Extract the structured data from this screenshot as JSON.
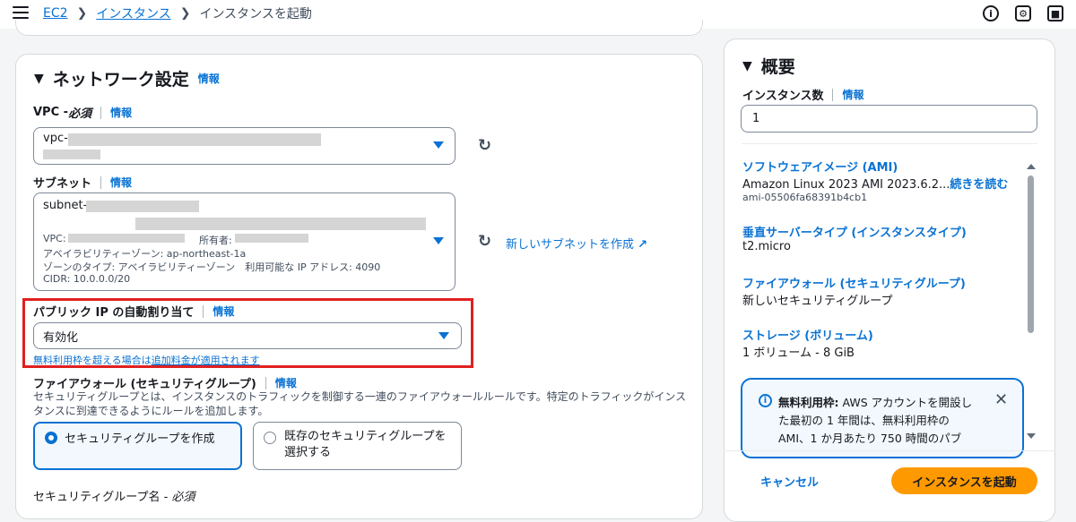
{
  "breadcrumb": {
    "ec2": "EC2",
    "instances": "インスタンス",
    "current": "インスタンスを起動"
  },
  "topbar_icons": [
    "info-icon",
    "settings-icon",
    "feedback-icon"
  ],
  "network": {
    "title": "ネットワーク設定",
    "info": "情報",
    "vpc": {
      "label": "VPC - ",
      "required": "必須",
      "info": "情報",
      "value": "vpc-"
    },
    "subnet": {
      "label": "サブネット",
      "info": "情報",
      "value": "subnet-",
      "vpc_line": "VPC:",
      "owner": "所有者:",
      "az": "アベイラビリティーゾーン: ap-northeast-1a",
      "zone_type": "ゾーンのタイプ: アベイラビリティーゾーン　利用可能な IP アドレス: 4090",
      "cidr": "CIDR: 10.0.0.0/20",
      "create_link": "新しいサブネットを作成"
    },
    "public_ip": {
      "label": "パブリック IP の自動割り当て",
      "info": "情報",
      "value": "有効化",
      "note_pre": "無料利用枠を超える場合は",
      "note_link": "追加料金が適用されます"
    },
    "firewall": {
      "label": "ファイアウォール (セキュリティグループ)",
      "info": "情報",
      "desc": "セキュリティグループとは、インスタンスのトラフィックを制御する一連のファイアウォールルールです。特定のトラフィックがインスタンスに到達できるようにルールを追加します。",
      "option_create": "セキュリティグループを作成",
      "option_existing": "既存のセキュリティグループを選択する"
    },
    "sg_name": {
      "label": "セキュリティグループ名 - ",
      "required": "必須"
    }
  },
  "summary": {
    "title": "概要",
    "count_label": "インスタンス数",
    "info": "情報",
    "count_value": "1",
    "ami_link": "ソフトウェアイメージ (AMI)",
    "ami_value": "Amazon Linux 2023 AMI 2023.6.2...",
    "ami_more": "続きを読む",
    "ami_id": "ami-05506fa68391b4cb1",
    "type_link": "垂直サーバータイプ (インスタンスタイプ)",
    "type_value": "t2.micro",
    "fw_link": "ファイアウォール (セキュリティグループ)",
    "fw_value": "新しいセキュリティグループ",
    "storage_link": "ストレージ (ボリューム)",
    "storage_value": "1 ボリューム - 8 GiB",
    "alert_bold": "無料利用枠:",
    "alert_text": " AWS アカウントを開設した最初の 1 年間は、無料利用枠の AMI、1 か月あたり 750 時間のパブ",
    "cancel": "キャンセル",
    "launch": "インスタンスを起動"
  }
}
